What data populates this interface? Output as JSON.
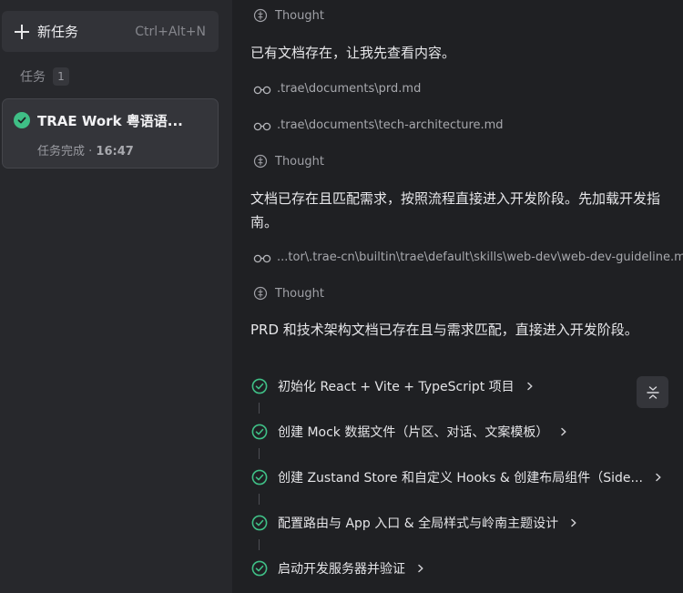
{
  "sidebar": {
    "new_task_label": "新任务",
    "new_task_shortcut": "Ctrl+Alt+N",
    "section_title": "任务",
    "section_count": "1",
    "task": {
      "title": "TRAE Work 粤语语...",
      "status": "任务完成",
      "separator": " · ",
      "time": "16:47"
    }
  },
  "main": {
    "thought_label": "Thought",
    "para1": "已有文档存在，让我先查看内容。",
    "file1": ".trae\\documents\\prd.md",
    "file2": ".trae\\documents\\tech-architecture.md",
    "para2": "文档已存在且匹配需求，按照流程直接进入开发阶段。先加载开发指南。",
    "file3": "...tor\\.trae-cn\\builtin\\trae\\default\\skills\\web-dev\\web-dev-guideline.md",
    "para3": "PRD 和技术架构文档已存在且与需求匹配，直接进入开发阶段。",
    "steps": [
      "初始化 React + Vite + TypeScript 项目",
      "创建 Mock 数据文件（片区、对话、文案模板）",
      "创建 Zustand Store 和自定义 Hooks & 创建布局组件（Side...",
      "配置路由与 App 入口 & 全局样式与岭南主题设计",
      "启动开发服务器并验证"
    ]
  },
  "colors": {
    "accent_green": "#3fbf86",
    "background": "#1f2023",
    "sidebar_bg": "#27282c"
  }
}
